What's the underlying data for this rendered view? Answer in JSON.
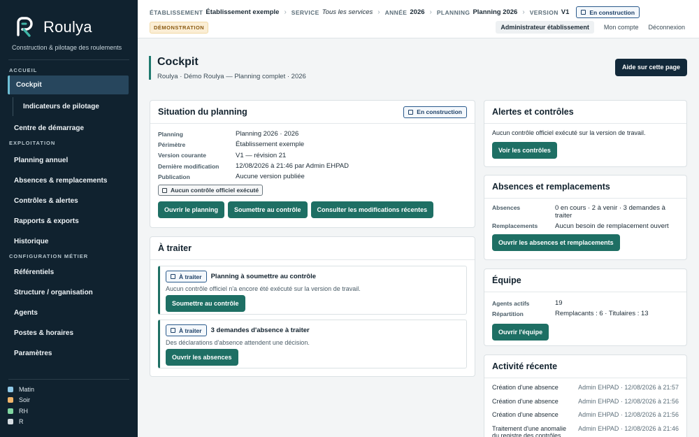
{
  "app": {
    "name": "Roulya",
    "tagline": "Construction & pilotage des roulements"
  },
  "sidebar": {
    "sections": {
      "accueil": "ACCUEIL",
      "exploitation": "EXPLOITATION",
      "configuration": "CONFIGURATION MÉTIER"
    },
    "items": {
      "cockpit": "Cockpit",
      "indicateurs": "Indicateurs de pilotage",
      "centre": "Centre de démarrage",
      "planning": "Planning annuel",
      "absences": "Absences & remplacements",
      "controles": "Contrôles & alertes",
      "rapports": "Rapports & exports",
      "historique": "Historique",
      "referentiels": "Référentiels",
      "structure": "Structure / organisation",
      "agents": "Agents",
      "postes": "Postes & horaires",
      "parametres": "Paramètres"
    },
    "legend": [
      {
        "label": "Matin",
        "color": "#8fc9e8"
      },
      {
        "label": "Soir",
        "color": "#f0b46a"
      },
      {
        "label": "RH",
        "color": "#7fd6a0"
      },
      {
        "label": "R",
        "color": "#d6dde2"
      }
    ]
  },
  "topbar": {
    "breadcrumb": {
      "etab_label": "ÉTABLISSEMENT",
      "etab_value": "Établissement exemple",
      "service_label": "SERVICE",
      "service_value": "Tous les services",
      "annee_label": "ANNÉE",
      "annee_value": "2026",
      "planning_label": "PLANNING",
      "planning_value": "Planning 2026",
      "version_label": "VERSION",
      "version_value": "V1",
      "status": "En construction"
    },
    "demo_badge": "DÉMONSTRATION",
    "links": {
      "role": "Administrateur établissement",
      "account": "Mon compte",
      "logout": "Déconnexion"
    }
  },
  "page": {
    "title": "Cockpit",
    "subtitle": "Roulya · Démo Roulya — Planning complet · 2026",
    "help_button": "Aide sur cette page"
  },
  "situation": {
    "title": "Situation du planning",
    "status": "En construction",
    "rows": [
      {
        "k": "Planning",
        "v": "Planning 2026 · 2026"
      },
      {
        "k": "Périmètre",
        "v": "Établissement exemple"
      },
      {
        "k": "Version courante",
        "v": "V1 — révision 21"
      },
      {
        "k": "Dernière modification",
        "v": "12/08/2026 à 21:46 par Admin EHPAD"
      },
      {
        "k": "Publication",
        "v": "Aucune version publiée"
      }
    ],
    "control_badge": "Aucun contrôle officiel exécuté",
    "buttons": {
      "open": "Ouvrir le planning",
      "submit": "Soumettre au contrôle",
      "changes": "Consulter les modifications récentes"
    }
  },
  "todo": {
    "title": "À traiter",
    "tasks": [
      {
        "badge": "À traiter",
        "title": "Planning à soumettre au contrôle",
        "desc": "Aucun contrôle officiel n'a encore été exécuté sur la version de travail.",
        "button": "Soumettre au contrôle"
      },
      {
        "badge": "À traiter",
        "title": "3 demandes d'absence à traiter",
        "desc": "Des déclarations d'absence attendent une décision.",
        "button": "Ouvrir les absences"
      }
    ]
  },
  "alerts": {
    "title": "Alertes et contrôles",
    "text": "Aucun contrôle officiel exécuté sur la version de travail.",
    "button": "Voir les contrôles"
  },
  "absences": {
    "title": "Absences et remplacements",
    "rows": [
      {
        "k": "Absences",
        "v": "0 en cours · 2 à venir · 3 demandes à traiter"
      },
      {
        "k": "Remplacements",
        "v": "Aucun besoin de remplacement ouvert"
      }
    ],
    "button": "Ouvrir les absences et remplacements"
  },
  "team": {
    "title": "Équipe",
    "rows": [
      {
        "k": "Agents actifs",
        "v": "19"
      },
      {
        "k": "Répartition",
        "v": "Remplacants : 6 · Titulaires : 13"
      }
    ],
    "button": "Ouvrir l'équipe"
  },
  "activity": {
    "title": "Activité récente",
    "rows": [
      {
        "a": "Création d'une absence",
        "b": "Admin EHPAD · 12/08/2026 à 21:57"
      },
      {
        "a": "Création d'une absence",
        "b": "Admin EHPAD · 12/08/2026 à 21:56"
      },
      {
        "a": "Création d'une absence",
        "b": "Admin EHPAD · 12/08/2026 à 21:56"
      },
      {
        "a": "Traitement d'une anomalie du registre des contrôles",
        "b": "Admin EHPAD · 12/08/2026 à 21:46"
      }
    ]
  }
}
